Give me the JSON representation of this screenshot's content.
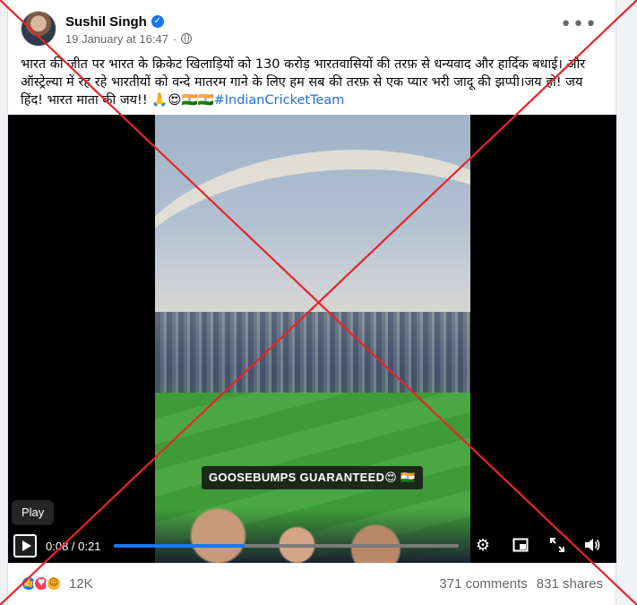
{
  "post": {
    "author": "Sushil Singh",
    "verified_icon": "verified-badge-icon",
    "timestamp": "19 January at 16:47",
    "privacy": "·",
    "more": "•••",
    "text_main": "भारत की जीत पर भारत के क्रिकेट खिलाड़ियों को 130 करोड़ भारतवासियों की तरफ़ से धन्यवाद और हार्दिक बधाई। और ऑस्ट्रेल्या में रह रहे भारतीयों को वन्दे मातरम गाने के लिए हम सब की तरफ़ से एक प्यार भरी जादू की झप्पी।जय हो! जय हिंद! भारत माता की जय!! 🙏😍🇮🇳🇮🇳",
    "hashtag": "#IndianCricketTeam"
  },
  "video": {
    "caption": "GOOSEBUMPS GUARANTEED😍 🇮🇳",
    "tooltip": "Play",
    "current_time": "0:08",
    "separator": " / ",
    "duration": "0:21",
    "progress": 0.38
  },
  "footer": {
    "reaction_count": "12K",
    "comments": "371 comments",
    "shares": "831 shares",
    "reactions": [
      "like",
      "love",
      "care"
    ]
  },
  "overlay": {
    "type": "red-x",
    "color": "#e8232a"
  }
}
